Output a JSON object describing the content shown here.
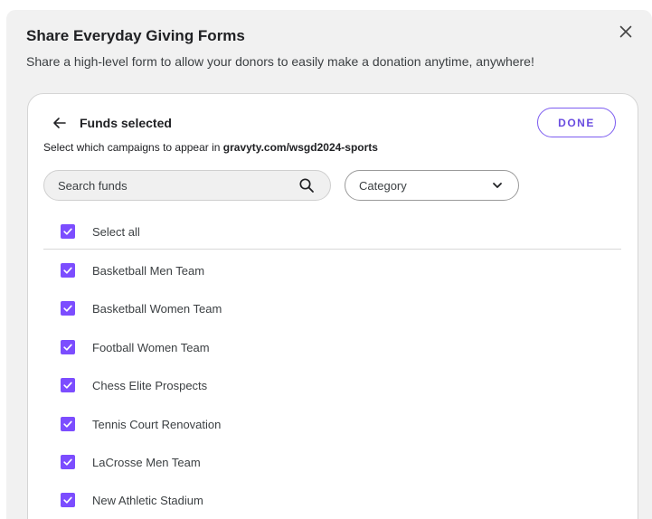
{
  "modal": {
    "title": "Share Everyday Giving Forms",
    "subtitle": "Share a high-level form to allow your donors to easily make a donation anytime, anywhere!",
    "close_icon": "close-icon"
  },
  "card": {
    "title": "Funds selected",
    "back_icon": "arrow-left-icon",
    "done_label": "DONE",
    "description_prefix": "Select which campaigns to appear in ",
    "description_url": "gravyty.com/wsgd2024-sports"
  },
  "search": {
    "placeholder": "Search funds",
    "icon": "search-icon"
  },
  "category": {
    "selected": "Category",
    "icon": "chevron-down-icon"
  },
  "select_all": {
    "label": "Select all",
    "checked": true
  },
  "funds": [
    {
      "label": "Basketball Men Team",
      "checked": true
    },
    {
      "label": "Basketball Women Team",
      "checked": true
    },
    {
      "label": "Football Women Team",
      "checked": true
    },
    {
      "label": "Chess Elite Prospects",
      "checked": true
    },
    {
      "label": "Tennis Court Renovation",
      "checked": true
    },
    {
      "label": "LaCrosse Men Team",
      "checked": true
    },
    {
      "label": "New Athletic Stadium",
      "checked": true
    }
  ],
  "colors": {
    "accent": "#7c4dff",
    "done_border": "#7c5cf0",
    "modal_bg": "#f1f1f1"
  }
}
